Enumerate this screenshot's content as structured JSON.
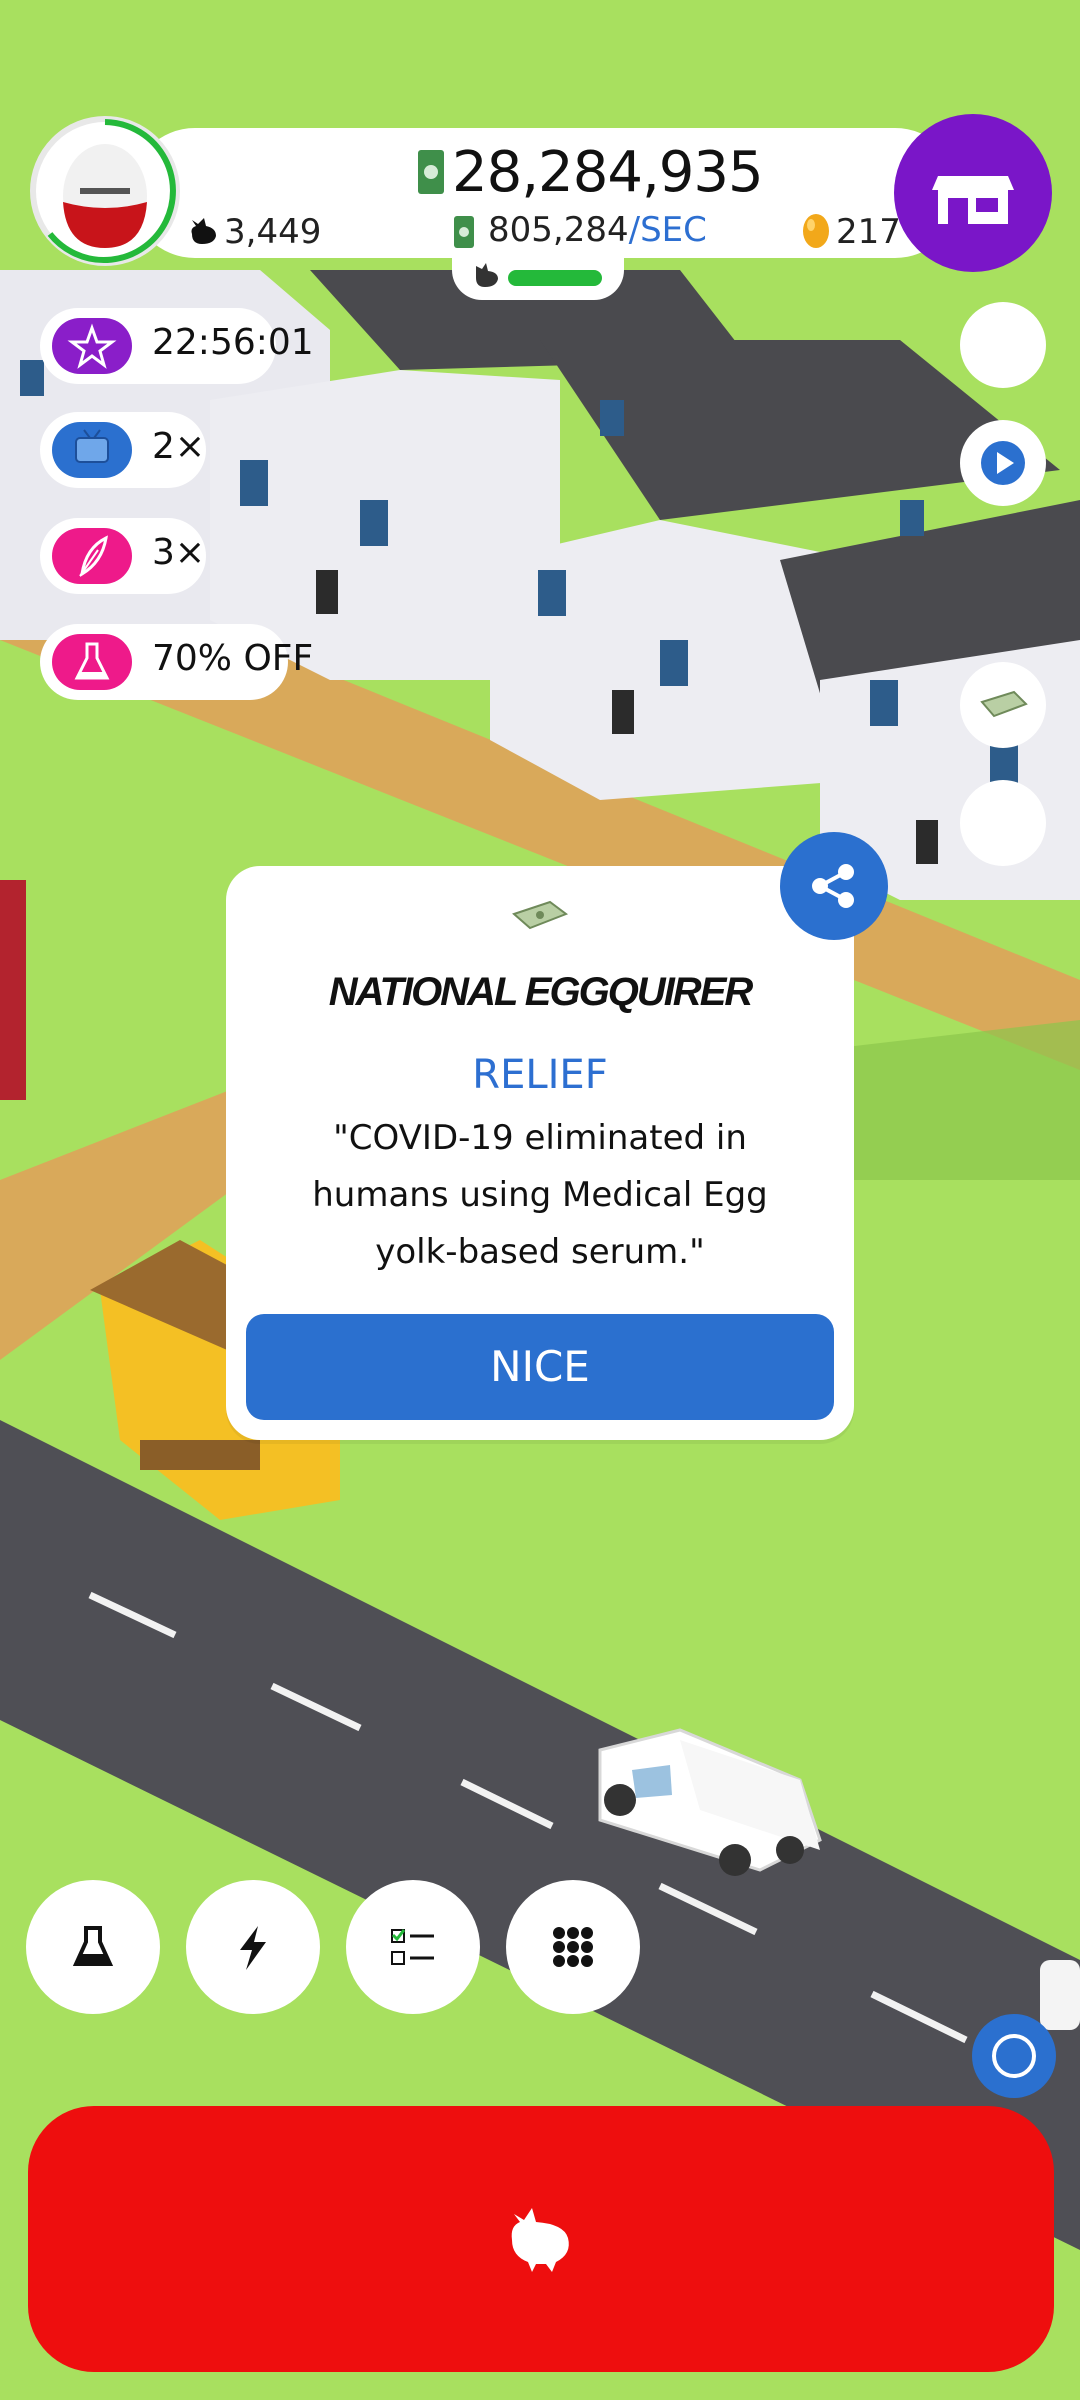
{
  "header": {
    "money": "28,284,935",
    "rate_value": "805,284",
    "rate_unit": "/SEC",
    "chickens": "3,449",
    "golden_eggs": "217",
    "egg_type": "red-white-egg-icon"
  },
  "boosts": [
    {
      "icon": "star-icon",
      "label": "22:56:01",
      "color": "#8a1ec9"
    },
    {
      "icon": "tv-icon",
      "label": "2×",
      "color": "#2b70cf"
    },
    {
      "icon": "feather-icon",
      "label": "3×",
      "color": "#ee1a8a"
    },
    {
      "icon": "flask-icon",
      "label": "70% OFF",
      "color": "#ee1a8a"
    }
  ],
  "news": {
    "masthead": "NATIONAL EGGQUIRER",
    "category": "RELIEF",
    "headline": "\"COVID-19 eliminated in humans using Medical Egg yolk-based serum.\"",
    "button": "NICE"
  },
  "bottom_buttons": [
    "flask-icon",
    "lightning-icon",
    "checklist-icon",
    "grid-icon"
  ],
  "colors": {
    "grass": "#a8e05f",
    "accent_blue": "#2b70cf",
    "shop_purple": "#7a16c8",
    "hatch_red": "#ee0e0e",
    "progress_green": "#24b93a"
  }
}
